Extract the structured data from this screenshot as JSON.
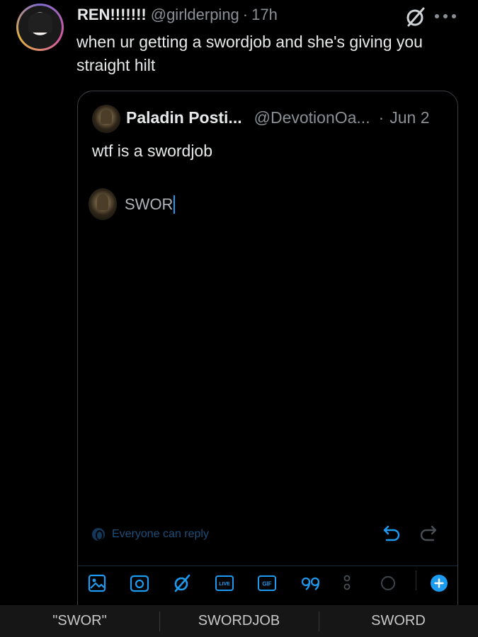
{
  "post": {
    "display_name": "REN!!!!!!!",
    "handle": "@girlderping",
    "separator": "·",
    "time": "17h",
    "text": "when ur getting a swordjob and she's giving you straight hilt"
  },
  "quoted_post": {
    "display_name": "Paladin Posti...",
    "handle": "@DevotionOa...",
    "separator": "·",
    "date": "Jun 2",
    "text": "wtf is a swordjob"
  },
  "composer": {
    "draft_text": "SWOR",
    "reply_setting": "Everyone can reply"
  },
  "toolbar": {
    "live_label": "LIVE",
    "gif_label": "GIF"
  },
  "keyboard_suggestions": [
    "\"SWOR\"",
    "SWORDJOB",
    "SWORD"
  ],
  "colors": {
    "background": "#000000",
    "accent": "#1d9bf0",
    "dim_accent": "#12395c",
    "muted_text": "#8b9096"
  }
}
